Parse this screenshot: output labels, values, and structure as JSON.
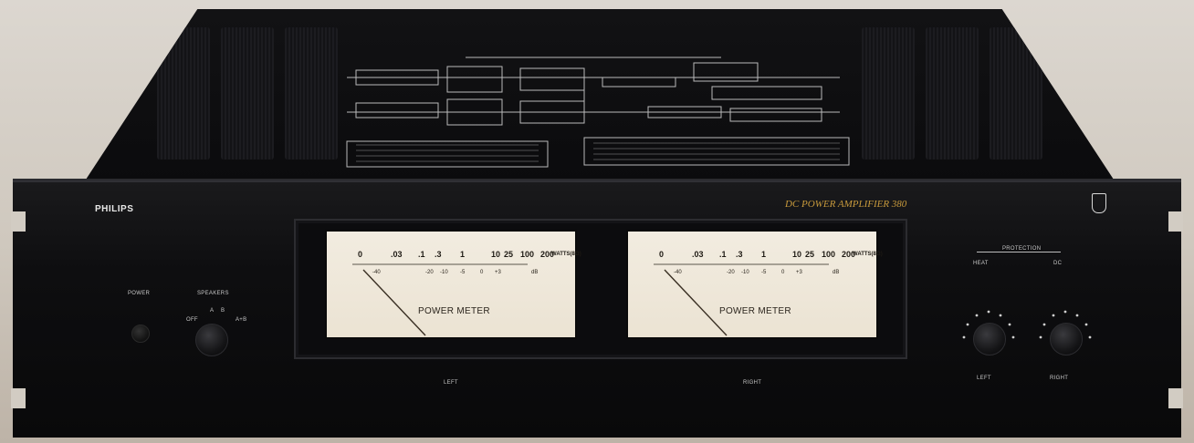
{
  "brand": "PHILIPS",
  "model_name": "DC POWER AMPLIFIER 380",
  "controls": {
    "power_label": "POWER",
    "speakers_label": "SPEAKERS",
    "speaker_positions": [
      "OFF",
      "A",
      "B",
      "A+B"
    ]
  },
  "protection": {
    "label": "PROTECTION",
    "left_label": "HEAT",
    "right_label": "DC"
  },
  "meters": [
    {
      "caption": "POWER METER",
      "channel_label": "LEFT",
      "scale_watts": [
        "0",
        ".03",
        ".1",
        ".3",
        "1",
        "10",
        "25",
        "100",
        "200"
      ],
      "scale_unit": "WATTS(8Ω)",
      "scale_db": [
        "-40",
        "-20",
        "-10",
        "-5",
        "0",
        "+3",
        "dB"
      ]
    },
    {
      "caption": "POWER METER",
      "channel_label": "RIGHT",
      "scale_watts": [
        "0",
        ".03",
        ".1",
        ".3",
        "1",
        "10",
        "25",
        "100",
        "200"
      ],
      "scale_unit": "WATTS(8Ω)",
      "scale_db": [
        "-40",
        "-20",
        "-10",
        "-5",
        "0",
        "+3",
        "dB"
      ]
    }
  ],
  "knob_labels": [
    "LEFT",
    "RIGHT"
  ],
  "colors": {
    "panel": "#0e0e10",
    "meter_face": "#eee7d9",
    "model_text": "#c89a3c",
    "needle": "#3a3024"
  }
}
